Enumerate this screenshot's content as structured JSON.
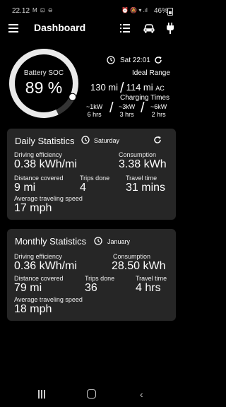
{
  "status_bar": {
    "time": "22.12",
    "left_icons": "M ⊡ ⊖",
    "right_icons": "⏰ 🔕 ▾ .ıl",
    "battery": "46%"
  },
  "app_bar": {
    "title": "Dashboard"
  },
  "battery": {
    "label": "Battery SOC",
    "value": "89 %",
    "soc_fraction": 0.89
  },
  "timestamp": "Sat 22:01",
  "ideal_range": {
    "label": "Ideal Range",
    "rated": "130 mi",
    "ac": "114 mi",
    "ac_suffix": "AC"
  },
  "charging_times": {
    "label": "Charging Times",
    "options": [
      {
        "power": "~1kW",
        "time": "6 hrs"
      },
      {
        "power": "~3kW",
        "time": "3 hrs"
      },
      {
        "power": "~6kW",
        "time": "2 hrs"
      }
    ]
  },
  "daily": {
    "title": "Daily Statistics",
    "period": "Saturday",
    "efficiency_label": "Driving efficiency",
    "efficiency_value": "0.38 kWh/mi",
    "consumption_label": "Consumption",
    "consumption_value": "3.38 kWh",
    "distance_label": "Distance covered",
    "distance_value": "9 mi",
    "trips_label": "Trips done",
    "trips_value": "4",
    "travel_label": "Travel time",
    "travel_value": "31 mins",
    "speed_label": "Average traveling speed",
    "speed_value": "17 mph"
  },
  "monthly": {
    "title": "Monthly Statistics",
    "period": "January",
    "efficiency_label": "Driving efficiency",
    "efficiency_value": "0.36 kWh/mi",
    "consumption_label": "Consumption",
    "consumption_value": "28.50 kWh",
    "distance_label": "Distance covered",
    "distance_value": "79 mi",
    "trips_label": "Trips done",
    "trips_value": "36",
    "travel_label": "Travel time",
    "travel_value": "4 hrs",
    "speed_label": "Average traveling speed",
    "speed_value": "18 mph"
  },
  "nav": {
    "back": "‹"
  }
}
